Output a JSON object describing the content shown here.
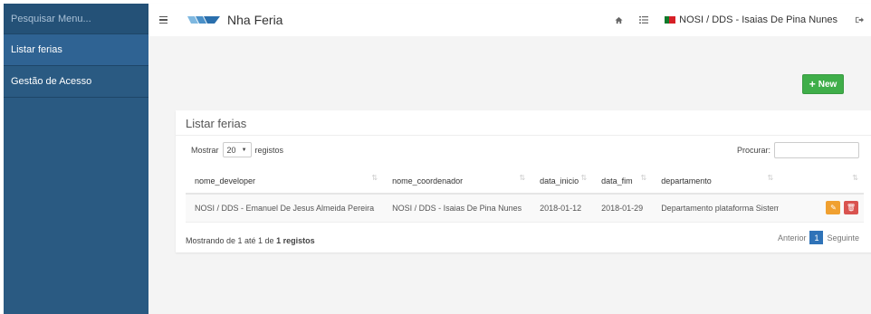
{
  "sidebar": {
    "search_placeholder": "Pesquisar Menu...",
    "items": [
      {
        "label": "Listar ferias"
      },
      {
        "label": "Gestão de Acesso"
      }
    ]
  },
  "header": {
    "brand": "Nha Feria",
    "user": "NOSI / DDS - Isaias De Pina Nunes"
  },
  "toolbar": {
    "new_label": "New"
  },
  "panel": {
    "title": "Listar ferias",
    "length_prefix": "Mostrar",
    "length_value": "20",
    "length_suffix": "registos",
    "search_label": "Procurar:"
  },
  "table": {
    "columns": [
      "nome_developer",
      "nome_coordenador",
      "data_inicio",
      "data_fim",
      "departamento",
      ""
    ],
    "rows": [
      {
        "nome_developer": "NOSI / DDS - Emanuel De Jesus Almeida Pereira",
        "nome_coordenador": "NOSI / DDS - Isaias De Pina Nunes",
        "data_inicio": "2018-01-12",
        "data_fim": "2018-01-29",
        "departamento": "Departamento plataforma Sistema"
      }
    ]
  },
  "footer": {
    "info_prefix": "Mostrando de 1 até 1 de",
    "info_bold": "1 registos",
    "prev": "Anterior",
    "page": "1",
    "next": "Seguinte"
  },
  "colors": {
    "sidebar": "#2a5a82",
    "new_button": "#3fae49",
    "edit_button": "#f0a030",
    "delete_button": "#d9534f",
    "pagination_active": "#2f73b8"
  },
  "icons": [
    "hamburger-icon",
    "logo-icon",
    "home-icon",
    "list-icon",
    "flag-icon",
    "logout-icon",
    "plus-icon",
    "sort-icon",
    "pencil-icon",
    "trash-icon",
    "caret-down-icon"
  ]
}
